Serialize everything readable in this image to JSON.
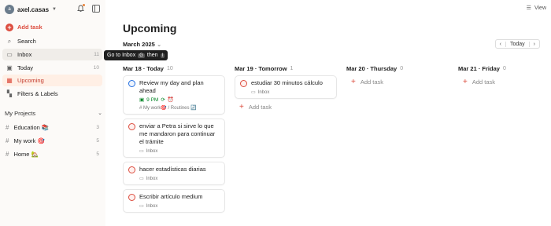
{
  "sidebar": {
    "username": "axel.casas",
    "avatar_initial": "a",
    "add_task": "Add task",
    "items": [
      {
        "label": "Search",
        "count": ""
      },
      {
        "label": "Inbox",
        "count": "11"
      },
      {
        "label": "Today",
        "count": "10"
      },
      {
        "label": "Upcoming",
        "count": ""
      },
      {
        "label": "Filters & Labels",
        "count": ""
      }
    ],
    "projects_title": "My Projects",
    "projects": [
      {
        "label": "Education 📚",
        "count": "3"
      },
      {
        "label": "My work 🎯",
        "count": "5"
      },
      {
        "label": "Home 🏡",
        "count": "5"
      }
    ]
  },
  "tooltip": {
    "text": "Go to Inbox",
    "key1": "G",
    "then": "then",
    "key2": "I"
  },
  "header": {
    "view": "View",
    "title": "Upcoming",
    "month": "March 2025",
    "today_btn": "Today",
    "prev": "‹",
    "next": "›"
  },
  "columns": [
    {
      "date": "Mar 18 · Today",
      "count": "10"
    },
    {
      "date": "Mar 19 · Tomorrow",
      "count": "1"
    },
    {
      "date": "Mar 20 · Thursday",
      "count": "0"
    },
    {
      "date": "Mar 21 · Friday",
      "count": "0"
    }
  ],
  "tasks": {
    "t1": {
      "title": "Review my day and plan ahead",
      "due": "9 PM",
      "project": "# My work🎯 / Routines 🔄"
    },
    "t2": {
      "title": "enviar a Petra si sirve lo que me mandaron para continuar el trámite",
      "project": "Inbox"
    },
    "t3": {
      "title": "hacer estadísticas diarias",
      "project": "Inbox"
    },
    "t4": {
      "title": "Escribir artículo medium",
      "project": "Inbox"
    },
    "t5": {
      "title": "estudiar 30 minutos cálculo",
      "project": "Inbox"
    }
  },
  "add_task_label": "Add task",
  "colors": {
    "accent": "#dc4c3e",
    "active_bg": "#ffefe5",
    "sidebar_bg": "#fcfaf8",
    "due_green": "#058527"
  }
}
